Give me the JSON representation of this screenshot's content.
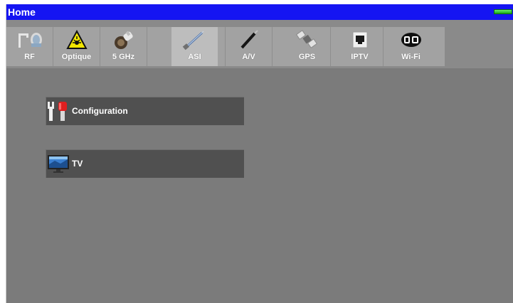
{
  "window": {
    "title": "Home",
    "battery_color": "#3cd03c",
    "title_bar_color": "#1515f2"
  },
  "tabs": [
    {
      "label": "RF",
      "icon": "rf-connector-icon",
      "active": false
    },
    {
      "label": "Optique",
      "icon": "laser-warning-icon",
      "active": false
    },
    {
      "label": "5 GHz",
      "icon": "antenna-icon",
      "active": false
    },
    {
      "label": "ASI",
      "icon": "asi-cable-icon",
      "active": true
    },
    {
      "label": "A/V",
      "icon": "av-cable-icon",
      "active": false
    },
    {
      "label": "GPS",
      "icon": "satellite-icon",
      "active": false
    },
    {
      "label": "IPTV",
      "icon": "ethernet-port-icon",
      "active": false
    },
    {
      "label": "Wi-Fi",
      "icon": "wifi-icon",
      "active": false
    }
  ],
  "menu": {
    "configuration_label": "Configuration",
    "tv_label": "TV"
  }
}
